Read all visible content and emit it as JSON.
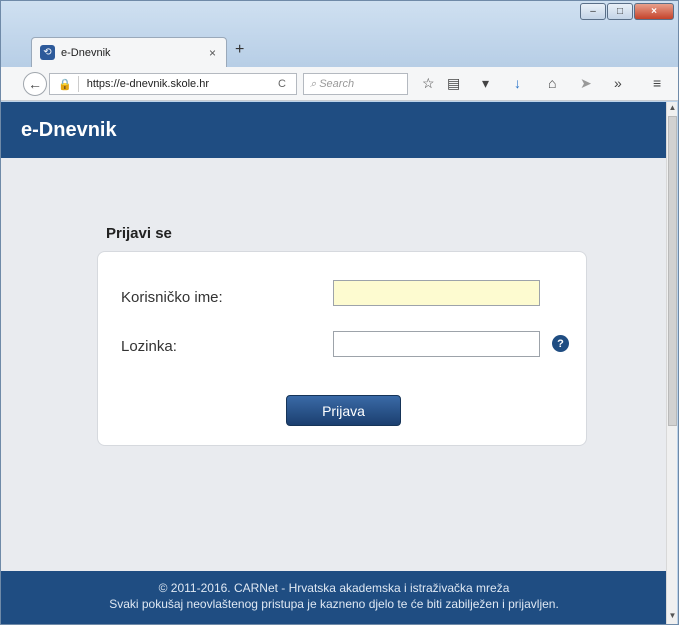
{
  "browser": {
    "tab_title": "e-Dnevnik",
    "tab_close": "×",
    "new_tab": "+",
    "url": "https://e-dnevnik.skole.hr",
    "reload": "C",
    "search_placeholder": "Search",
    "window_controls": [
      "–",
      "□",
      "×"
    ],
    "toolbar_icons": [
      "star-icon",
      "reader-icon",
      "pocket-icon",
      "download-icon",
      "home-icon",
      "send-icon",
      "overflow-icon",
      "menu-icon"
    ]
  },
  "site": {
    "title": "e-Dnevnik"
  },
  "login": {
    "heading": "Prijavi se",
    "username_label": "Korisničko ime:",
    "password_label": "Lozinka:",
    "help": "?",
    "submit": "Prijava"
  },
  "footer": {
    "line1": "© 2011-2016. CARNet - Hrvatska akademska i istraživačka mreža",
    "line2": "Svaki pokušaj neovlaštenog pristupa je kazneno djelo te će biti zabilježen i prijavljen."
  },
  "colors": {
    "primary": "#1f4d82",
    "input_active": "#fdfbd0"
  }
}
